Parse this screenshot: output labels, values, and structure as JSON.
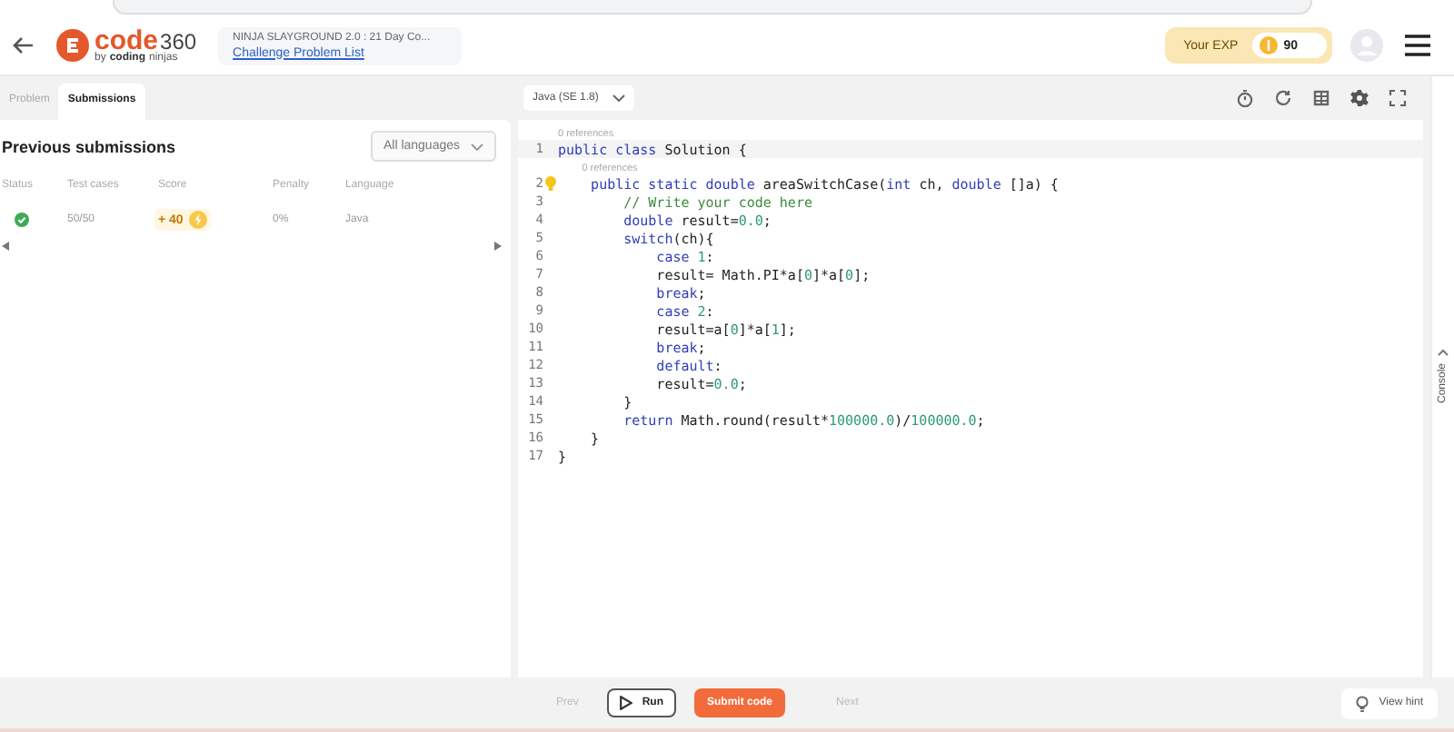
{
  "header": {
    "logo_main": "code",
    "logo_number": "360",
    "logo_by": "by",
    "logo_brand": "coding",
    "logo_brand2": "ninjas",
    "breadcrumb_title": "NINJA SLAYGROUND 2.0 : 21 Day Co...",
    "breadcrumb_link": "Challenge Problem List",
    "exp_label": "Your EXP",
    "exp_value": "90"
  },
  "tabs": [
    {
      "label": "Problem",
      "selected": false
    },
    {
      "label": "Submissions",
      "selected": true
    }
  ],
  "submissions": {
    "title": "Previous submissions",
    "filter": "All languages",
    "columns": [
      "Status",
      "Test cases",
      "Score",
      "Penalty",
      "Language"
    ],
    "rows": [
      {
        "passed": true,
        "test_cases": "50/50",
        "score": "+ 40",
        "penalty": "0%",
        "language": "Java"
      }
    ]
  },
  "editor": {
    "language": "Java (SE 1.8)",
    "lines": [
      {
        "number": "1",
        "reference": "0 references",
        "segments": [
          {
            "text": "public class ",
            "kind": "keyword"
          },
          {
            "text": "Solution {",
            "kind": "plain"
          }
        ]
      },
      {
        "number": "2",
        "reference": "0 references",
        "hint": true,
        "segments": [
          {
            "text": "    public static double ",
            "kind": "keyword"
          },
          {
            "text": "areaSwitchCase(",
            "kind": "plain"
          },
          {
            "text": "int ",
            "kind": "keyword"
          },
          {
            "text": "ch, ",
            "kind": "plain"
          },
          {
            "text": "double ",
            "kind": "keyword"
          },
          {
            "text": "[]a) {",
            "kind": "plain"
          }
        ]
      },
      {
        "number": "3",
        "segments": [
          {
            "text": "        // Write your code here",
            "kind": "comment"
          }
        ]
      },
      {
        "number": "4",
        "segments": [
          {
            "text": "        double ",
            "kind": "keyword"
          },
          {
            "text": "result=",
            "kind": "plain"
          },
          {
            "text": "0.0",
            "kind": "number"
          },
          {
            "text": ";",
            "kind": "plain"
          }
        ]
      },
      {
        "number": "5",
        "segments": [
          {
            "text": "        switch",
            "kind": "keyword"
          },
          {
            "text": "(ch){",
            "kind": "plain"
          }
        ]
      },
      {
        "number": "6",
        "segments": [
          {
            "text": "            case ",
            "kind": "keyword"
          },
          {
            "text": "1",
            "kind": "number"
          },
          {
            "text": ":",
            "kind": "plain"
          }
        ]
      },
      {
        "number": "7",
        "segments": [
          {
            "text": "            result= Math.PI*a[",
            "kind": "plain"
          },
          {
            "text": "0",
            "kind": "number"
          },
          {
            "text": "]*a[",
            "kind": "plain"
          },
          {
            "text": "0",
            "kind": "number"
          },
          {
            "text": "];",
            "kind": "plain"
          }
        ]
      },
      {
        "number": "8",
        "segments": [
          {
            "text": "            break",
            "kind": "keyword"
          },
          {
            "text": ";",
            "kind": "plain"
          }
        ]
      },
      {
        "number": "9",
        "segments": [
          {
            "text": "            case ",
            "kind": "keyword"
          },
          {
            "text": "2",
            "kind": "number"
          },
          {
            "text": ":",
            "kind": "plain"
          }
        ]
      },
      {
        "number": "10",
        "segments": [
          {
            "text": "            result=a[",
            "kind": "plain"
          },
          {
            "text": "0",
            "kind": "number"
          },
          {
            "text": "]*a[",
            "kind": "plain"
          },
          {
            "text": "1",
            "kind": "number"
          },
          {
            "text": "];",
            "kind": "plain"
          }
        ]
      },
      {
        "number": "11",
        "segments": [
          {
            "text": "            break",
            "kind": "keyword"
          },
          {
            "text": ";",
            "kind": "plain"
          }
        ]
      },
      {
        "number": "12",
        "segments": [
          {
            "text": "            default",
            "kind": "keyword"
          },
          {
            "text": ":",
            "kind": "plain"
          }
        ]
      },
      {
        "number": "13",
        "segments": [
          {
            "text": "            result=",
            "kind": "plain"
          },
          {
            "text": "0.0",
            "kind": "number"
          },
          {
            "text": ";",
            "kind": "plain"
          }
        ]
      },
      {
        "number": "14",
        "segments": [
          {
            "text": "        }",
            "kind": "plain"
          }
        ]
      },
      {
        "number": "15",
        "segments": [
          {
            "text": "        return ",
            "kind": "keyword"
          },
          {
            "text": "Math.round(result*",
            "kind": "plain"
          },
          {
            "text": "100000.0",
            "kind": "number"
          },
          {
            "text": ")/",
            "kind": "plain"
          },
          {
            "text": "100000.0",
            "kind": "number"
          },
          {
            "text": ";",
            "kind": "plain"
          }
        ]
      },
      {
        "number": "16",
        "segments": [
          {
            "text": "    }",
            "kind": "plain"
          }
        ]
      },
      {
        "number": "17",
        "segments": [
          {
            "text": "}",
            "kind": "plain"
          }
        ]
      }
    ]
  },
  "console": {
    "label": "Console"
  },
  "footer": {
    "prev": "Prev",
    "run": "Run",
    "submit": "Submit code",
    "next": "Next",
    "hint": "View hint"
  }
}
